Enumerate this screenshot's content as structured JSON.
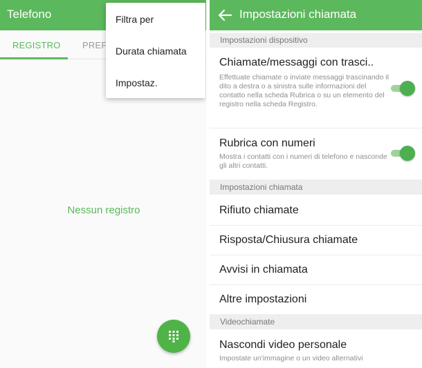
{
  "left": {
    "app_title": "Telefono",
    "tabs": [
      {
        "label": "REGISTRO",
        "active": true
      },
      {
        "label": "PREFE",
        "active": false
      }
    ],
    "overflow_menu": [
      "Filtra per",
      "Durata chiamata",
      "Impostaz."
    ],
    "empty_message": "Nessun registro",
    "fab_icon": "dialpad-icon"
  },
  "right": {
    "title": "Impostazioni chiamata",
    "back_icon": "arrow-left-icon",
    "sections": [
      {
        "header": "Impostazioni dispositivo",
        "items": [
          {
            "title": "Chiamate/messaggi con trasci..",
            "description": "Effettuate chiamate o inviate messaggi trascinando il dito a destra o a sinistra sulle informazioni del contatto nella scheda Rubrica o su un elemento del registro nella scheda Registro.",
            "toggle": true
          },
          {
            "title": "Rubrica con numeri",
            "description": "Mostra i contatti con i numeri di telefono e nasconde gli altri contatti.",
            "toggle": true
          }
        ]
      },
      {
        "header": "Impostazioni chiamata",
        "items": [
          {
            "title": "Rifiuto chiamate"
          },
          {
            "title": "Risposta/Chiusura chiamate"
          },
          {
            "title": "Avvisi in chiamata"
          },
          {
            "title": "Altre impostazioni"
          }
        ]
      },
      {
        "header": "Videochiamate",
        "items": [
          {
            "title": "Nascondi video personale",
            "description": "Impostate un'immagine o un video alternativi"
          }
        ]
      }
    ]
  },
  "colors": {
    "accent": "#5cb85c",
    "toggle_on": "#4caf50",
    "section_bg": "#eeeeee"
  }
}
